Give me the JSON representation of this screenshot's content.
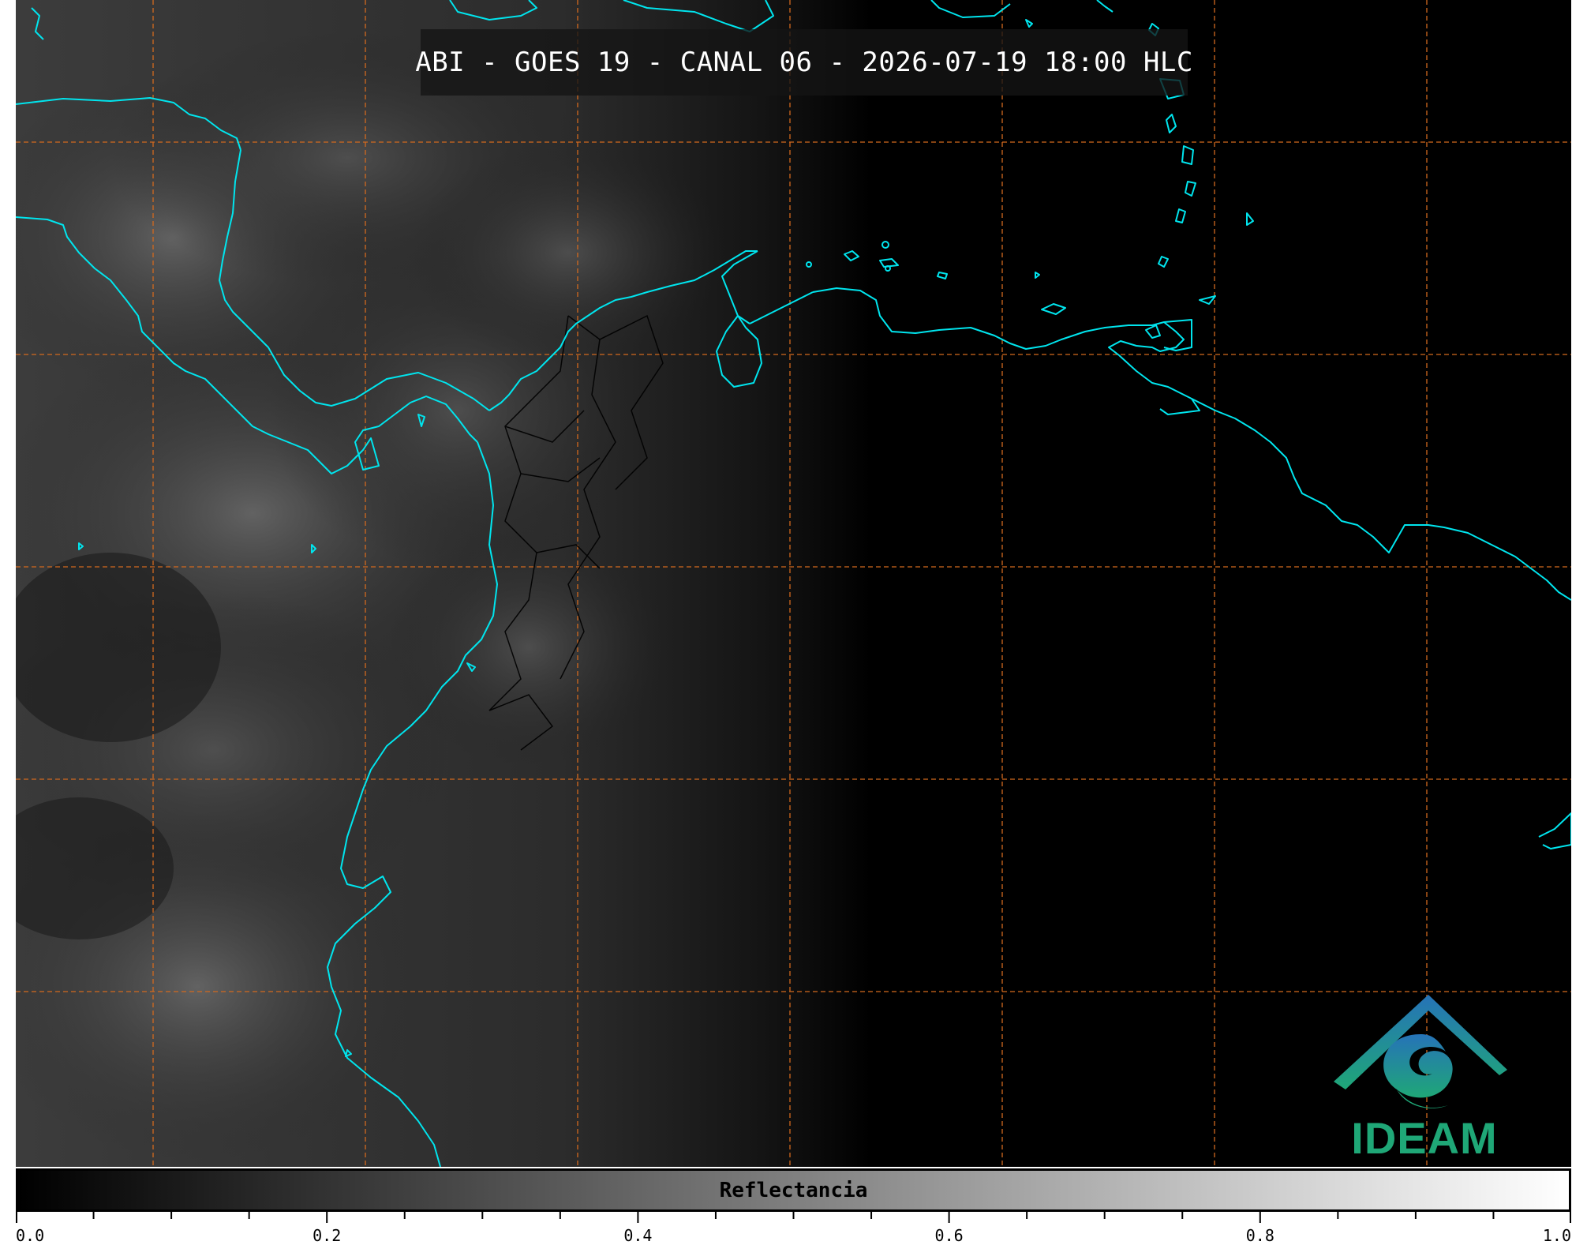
{
  "title": "ABI - GOES 19 - CANAL 06 - 2026-07-19 18:00 HLC",
  "logo": {
    "text": "IDEAM",
    "icon": "ideam-logo-icon"
  },
  "colorbar": {
    "label": "Reflectancia",
    "min": 0.0,
    "max": 1.0,
    "ticks": [
      "0.0",
      "0.2",
      "0.4",
      "0.6",
      "0.8",
      "1.0"
    ],
    "gradient": [
      "#000000",
      "#ffffff"
    ]
  },
  "colors": {
    "coastline": "#00e5ee",
    "gridlines": "#d2691e",
    "borders": "#000000"
  }
}
